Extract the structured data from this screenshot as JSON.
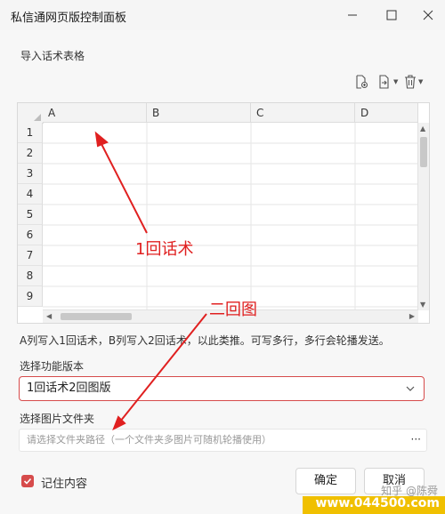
{
  "window": {
    "title": "私信通网页版控制面板",
    "controls": [
      "minimize",
      "maximize",
      "close"
    ]
  },
  "import_section": {
    "label": "导入话术表格",
    "toolbar_icons": [
      "file-add-icon",
      "file-import-icon",
      "trash-icon"
    ]
  },
  "sheet": {
    "columns": [
      "A",
      "B",
      "C",
      "D"
    ],
    "rows": [
      "1",
      "2",
      "3",
      "4",
      "5",
      "6",
      "7",
      "8",
      "9"
    ]
  },
  "annotations": {
    "arrow1_label": "1回话术",
    "arrow2_label": "二回图",
    "color": "#e02020"
  },
  "hint_text": "A列写入1回话术，B列写入2回话术，以此类推。可写多行，多行会轮播发送。",
  "function_version": {
    "label": "选择功能版本",
    "selected": "1回话术2回图版"
  },
  "image_folder": {
    "label": "选择图片文件夹",
    "placeholder": "请选择文件夹路径（一个文件夹多图片可随机轮播使用）",
    "browse_label": "···"
  },
  "remember": {
    "label": "记住内容",
    "checked": true
  },
  "buttons": {
    "ok": "确定",
    "cancel": "取消"
  },
  "watermark": {
    "site": "www.044500.com",
    "zhihu": "知乎 @陈舜"
  },
  "colors": {
    "accent": "#d64b4b",
    "watermark_bg": "#f0c000"
  }
}
